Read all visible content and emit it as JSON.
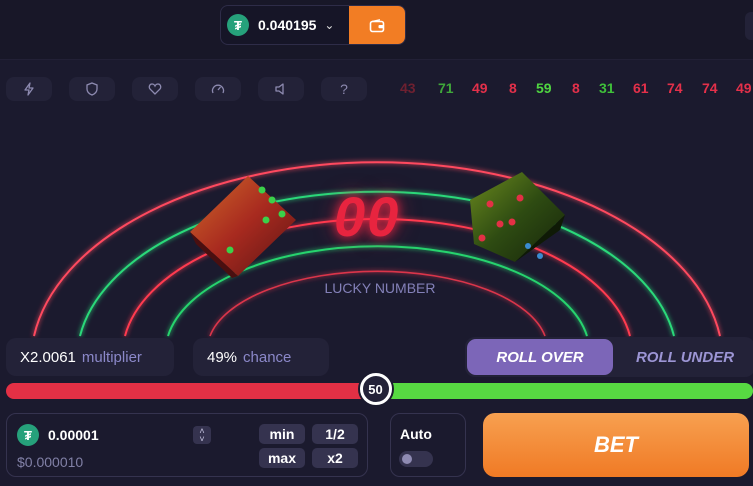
{
  "header": {
    "balance": "0.040195",
    "currency_icon": "tether-icon",
    "dropdown_icon": "chevron-down-icon",
    "wallet_icon": "wallet-icon",
    "colors": {
      "accent": "#f27d24",
      "tether": "#26a17b"
    }
  },
  "toolbar": {
    "icons": [
      "lightning-icon",
      "shield-icon",
      "heart-icon",
      "speedometer-icon",
      "volume-icon",
      "help-icon"
    ],
    "help_label": "?"
  },
  "history": [
    {
      "value": "43",
      "color": "#6e2030"
    },
    {
      "value": "71",
      "color": "#3fa73a"
    },
    {
      "value": "49",
      "color": "#e3304a"
    },
    {
      "value": "8",
      "color": "#e3304a"
    },
    {
      "value": "59",
      "color": "#4fd541"
    },
    {
      "value": "8",
      "color": "#e3304a"
    },
    {
      "value": "31",
      "color": "#3fbf3a"
    },
    {
      "value": "61",
      "color": "#e3304a"
    },
    {
      "value": "74",
      "color": "#e3304a"
    },
    {
      "value": "74",
      "color": "#e3304a"
    },
    {
      "value": "49",
      "color": "#e3304a"
    }
  ],
  "arena": {
    "lucky_number": "00",
    "label": "LUCKY NUMBER"
  },
  "stats": {
    "multiplier_value": "X2.0061",
    "multiplier_label": "multiplier",
    "chance_value": "49%",
    "chance_label": "chance"
  },
  "mode": {
    "roll_over": "ROLL OVER",
    "roll_under": "ROLL UNDER",
    "selected": "ROLL OVER"
  },
  "slider": {
    "value": "50",
    "percent": 50
  },
  "bet": {
    "amount": "0.00001",
    "usd": "$0.000010",
    "min": "min",
    "half": "1/2",
    "max": "max",
    "double": "x2",
    "stepper_up": "˄",
    "stepper_down": "˅"
  },
  "auto": {
    "label": "Auto",
    "enabled": false
  },
  "bet_button": "BET"
}
